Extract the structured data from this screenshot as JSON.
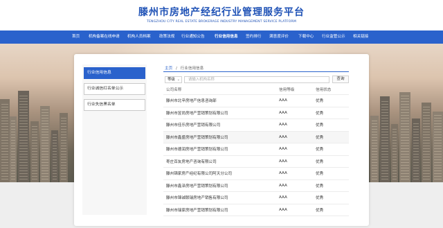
{
  "header": {
    "title": "滕州市房地产经纪行业管理服务平台",
    "subtitle": "TENGZHOU CITY REAL ESTATE BROKERAGE INDUSTRY MANAGEMENT SERVICE PLATFORM"
  },
  "nav": {
    "items": [
      {
        "label": "首页"
      },
      {
        "label": "机构备案在线申请"
      },
      {
        "label": "机构人员档案"
      },
      {
        "label": "政策法规"
      },
      {
        "label": "行业通知公告"
      },
      {
        "label": "行业信用信息"
      },
      {
        "label": "签约排行"
      },
      {
        "label": "满意度评价"
      },
      {
        "label": "下载中心"
      },
      {
        "label": "行业监管公示"
      },
      {
        "label": "相关链接"
      }
    ],
    "active_index": 5
  },
  "sidebar": {
    "items": [
      {
        "label": "行业信用信息"
      },
      {
        "label": "行业诚信红名单公示"
      },
      {
        "label": "行业失信黑名单"
      }
    ]
  },
  "breadcrumb": {
    "home": "主页",
    "separator": "/",
    "current": "行业信用信息"
  },
  "filters": {
    "level_label": "等级",
    "name_placeholder": "请输入机构名称",
    "query_button": "查询"
  },
  "table": {
    "headers": [
      "公司名称",
      "信用等级",
      "信用状态"
    ],
    "rows": [
      [
        "滕州市北辛房地产信息咨询部",
        "AAA",
        "优秀"
      ],
      [
        "滕州市昱尚房地产营销策划有限公司",
        "AAA",
        "优秀"
      ],
      [
        "滕州市佳乐房地产营销有限公司",
        "AAA",
        "优秀"
      ],
      [
        "滕州市鑫盛房地产营销策划有限公司",
        "AAA",
        "优秀"
      ],
      [
        "滕州市德润房地产营销策划有限公司",
        "AAA",
        "优秀"
      ],
      [
        "枣庄百友房地产咨询有限公司",
        "AAA",
        "优秀"
      ],
      [
        "滕州锦家房产经纪有限公司阿天分公司",
        "AAA",
        "优秀"
      ],
      [
        "滕州市鑫泽房地产营销策划有限公司",
        "AAA",
        "优秀"
      ],
      [
        "滕州市锦诚联瑞房地产销售有限公司",
        "AAA",
        "优秀"
      ],
      [
        "滕州市瑞家房地产营销策划有限公司",
        "AAA",
        "优秀"
      ]
    ]
  },
  "colors": {
    "brand_blue": "#2a62cc",
    "title_blue": "#1f52b6"
  }
}
